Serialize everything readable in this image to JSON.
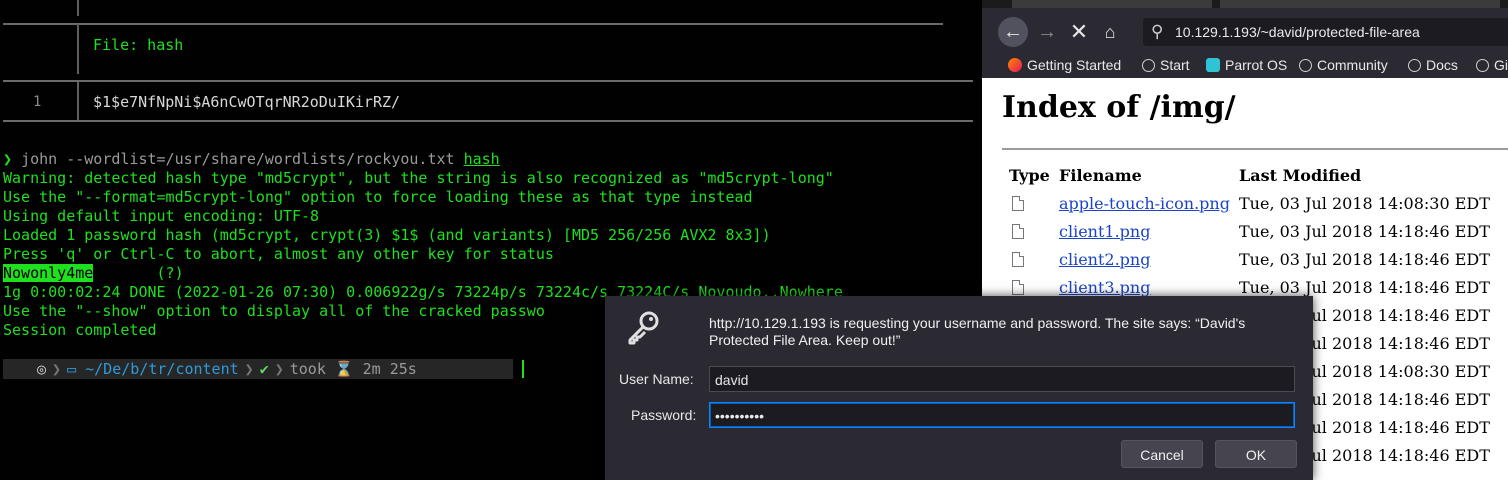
{
  "terminal": {
    "bat_title": "File: hash",
    "bat_line_number": "1",
    "bat_line": "$1$e7NfNpNi$A6nCwOTqrNR2oDuIKirRZ/",
    "command": {
      "prompt": "❯",
      "text": "john --wordlist=/usr/share/wordlists/rockyou.txt",
      "arg": "hash"
    },
    "output": [
      "Warning: detected hash type \"md5crypt\", but the string is also recognized as \"md5crypt-long\"",
      "Use the \"--format=md5crypt-long\" option to force loading these as that type instead",
      "Using default input encoding: UTF-8",
      "Loaded 1 password hash (md5crypt, crypt(3) $1$ (and variants) [MD5 256/256 AVX2 8x3])",
      "Press 'q' or Ctrl-C to abort, almost any other key for status"
    ],
    "cracked_password": "Nowonly4me",
    "cracked_suffix": "       (?)",
    "output_after": [
      "1g 0:00:02:24 DONE (2022-01-26 07:30) 0.006922g/s 73224p/s 73224c/s 73224C/s Novoudo..Nowhere",
      "Use the \"--show\" option to display all of the cracked passwo",
      "Session completed"
    ],
    "statusbar": {
      "ghost_icon": "◎",
      "home_icon": "▭",
      "path_prefix": "~/De/b/tr/",
      "path_dir": "content",
      "check": "✔",
      "took_label": "took ⌛ 2m 25s"
    },
    "colors": {
      "green": "#1ee01e",
      "blue": "#2f9ad8"
    }
  },
  "browser": {
    "url": "10.129.1.193/~david/protected-file-area",
    "bookmarks": [
      "Getting Started",
      "Start",
      "Parrot OS",
      "Community",
      "Docs",
      "Gi"
    ],
    "page_title": "Index of /img/",
    "columns": [
      "Type",
      "Filename",
      "Last Modified"
    ],
    "rows": [
      {
        "name": "apple-touch-icon.png",
        "date": "Tue, 03 Jul 2018 14:08:30 EDT"
      },
      {
        "name": "client1.png",
        "date": "Tue, 03 Jul 2018 14:18:46 EDT"
      },
      {
        "name": "client2.png",
        "date": "Tue, 03 Jul 2018 14:18:46 EDT"
      },
      {
        "name": "client3.png",
        "date": "Tue, 03 Jul 2018 14:18:46 EDT"
      },
      {
        "name": "",
        "date": "Tue, 03 Jul 2018 14:18:46 EDT"
      },
      {
        "name": "",
        "date": "Tue, 03 Jul 2018 14:18:46 EDT"
      },
      {
        "name": "",
        "date": "Tue, 03 Jul 2018 14:08:30 EDT"
      },
      {
        "name": "",
        "date": "Tue, 03 Jul 2018 14:18:46 EDT"
      },
      {
        "name": "",
        "date": "Tue, 03 Jul 2018 14:18:46 EDT"
      },
      {
        "name": "",
        "date": "Tue, 03 Jul 2018 14:18:46 EDT"
      }
    ]
  },
  "auth_dialog": {
    "message": "http://10.129.1.193 is requesting your username and password. The site says: “David's Protected File Area. Keep out!”",
    "username_label": "User Name:",
    "username_value": "david",
    "password_label": "Password:",
    "password_value": "••••••••••",
    "cancel_label": "Cancel",
    "ok_label": "OK"
  }
}
